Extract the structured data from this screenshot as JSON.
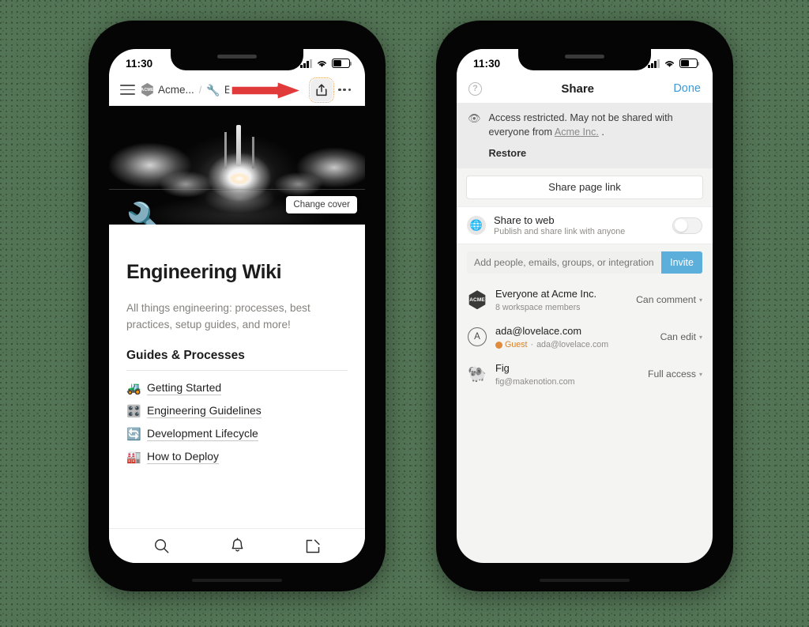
{
  "background": {
    "color": "#537455"
  },
  "phone_left": {
    "status": {
      "time": "11:30",
      "signal": "signal-bars",
      "wifi": "wifi-icon",
      "battery": "battery-icon"
    },
    "navbar": {
      "menu": "hamburger-icon",
      "workspace_badge": "ACME",
      "workspace_label": "Acme...",
      "separator": "/",
      "page_emoji": "🔧",
      "page_label": "Engine",
      "share_icon": "share-icon",
      "overflow": "more-options-icon",
      "annotation": "red-arrow-pointing-to-share"
    },
    "cover": {
      "alt": "rocket launch at night",
      "change_cover_label": "Change cover",
      "page_emoji": "🔧"
    },
    "page": {
      "title": "Engineering Wiki",
      "description": "All things engineering: processes, best practices, setup guides, and more!",
      "section_heading": "Guides & Processes",
      "links": [
        {
          "emoji": "🚜",
          "label": "Getting Started"
        },
        {
          "emoji": "🎛️",
          "label": "Engineering Guidelines"
        },
        {
          "emoji": "🔄",
          "label": "Development Lifecycle"
        },
        {
          "emoji": "🏭",
          "label": "How to Deploy"
        }
      ]
    },
    "tabbar": {
      "search": "search-icon",
      "notifications": "bell-icon",
      "compose": "compose-icon"
    }
  },
  "phone_right": {
    "status": {
      "time": "11:30",
      "signal": "signal-bars",
      "wifi": "wifi-icon",
      "battery": "battery-icon"
    },
    "header": {
      "help": "help-icon",
      "title": "Share",
      "done_label": "Done",
      "done_color": "#3d9bd9"
    },
    "notice": {
      "icon": "eye-off-icon",
      "text_before": "Access restricted. May not be shared with everyone from ",
      "link": "Acme Inc.",
      "text_after": " .",
      "restore_label": "Restore"
    },
    "share_link_label": "Share page link",
    "share_to_web": {
      "icon": "globe-icon",
      "title": "Share to web",
      "subtitle": "Publish and share link with anyone",
      "toggle_on": false
    },
    "invite": {
      "placeholder": "Add people, emails, groups, or integrations",
      "value": "",
      "button_label": "Invite",
      "button_color": "#5caedb"
    },
    "people": [
      {
        "avatar_type": "acme-hex",
        "avatar_text": "ACME",
        "name": "Everyone at Acme Inc.",
        "sub": "8 workspace members",
        "permission": "Can comment"
      },
      {
        "avatar_type": "letter-circle",
        "avatar_text": "A",
        "name": "ada@lovelace.com",
        "badge": "Guest",
        "sub": "ada@lovelace.com",
        "permission": "Can edit"
      },
      {
        "avatar_type": "emoji",
        "avatar_text": "🐏",
        "name": "Fig",
        "sub": "fig@makenotion.com",
        "permission": "Full access"
      }
    ]
  }
}
